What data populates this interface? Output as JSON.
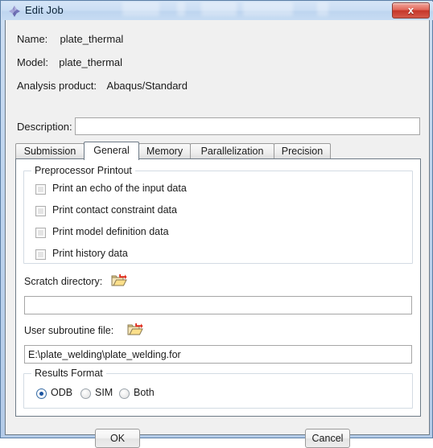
{
  "window": {
    "title": "Edit Job",
    "icon": "abaqus-diamond-icon",
    "close_label": "x",
    "accent_color": "#1b54a0",
    "titlebar_color": "#cbdef4",
    "close_color": "#c5372a"
  },
  "info": {
    "name_label": "Name:",
    "name_value": "plate_thermal",
    "model_label": "Model:",
    "model_value": "plate_thermal",
    "product_label": "Analysis product:",
    "product_value": "Abaqus/Standard",
    "description_label": "Description:",
    "description_value": "",
    "description_placeholder": ""
  },
  "tabs": [
    {
      "label": "Submission",
      "active": false
    },
    {
      "label": "General",
      "active": true
    },
    {
      "label": "Memory",
      "active": false
    },
    {
      "label": "Parallelization",
      "active": false
    },
    {
      "label": "Precision",
      "active": false
    }
  ],
  "preprocessor": {
    "group_title": "Preprocessor Printout",
    "options": [
      {
        "label": "Print an echo of the input data",
        "checked": false
      },
      {
        "label": "Print contact constraint data",
        "checked": false
      },
      {
        "label": "Print model definition data",
        "checked": false
      },
      {
        "label": "Print history data",
        "checked": false
      }
    ]
  },
  "scratch": {
    "label": "Scratch directory:",
    "browse_icon": "open-folder-icon",
    "value": "",
    "placeholder": ""
  },
  "subroutine": {
    "label": "User subroutine file:",
    "browse_icon": "open-folder-icon",
    "value": "E:\\plate_welding\\plate_welding.for",
    "placeholder": ""
  },
  "results_format": {
    "group_title": "Results Format",
    "options": [
      {
        "label": "ODB",
        "selected": true
      },
      {
        "label": "SIM",
        "selected": false
      },
      {
        "label": "Both",
        "selected": false
      }
    ]
  },
  "footer": {
    "ok_label": "OK",
    "cancel_label": "Cancel"
  }
}
